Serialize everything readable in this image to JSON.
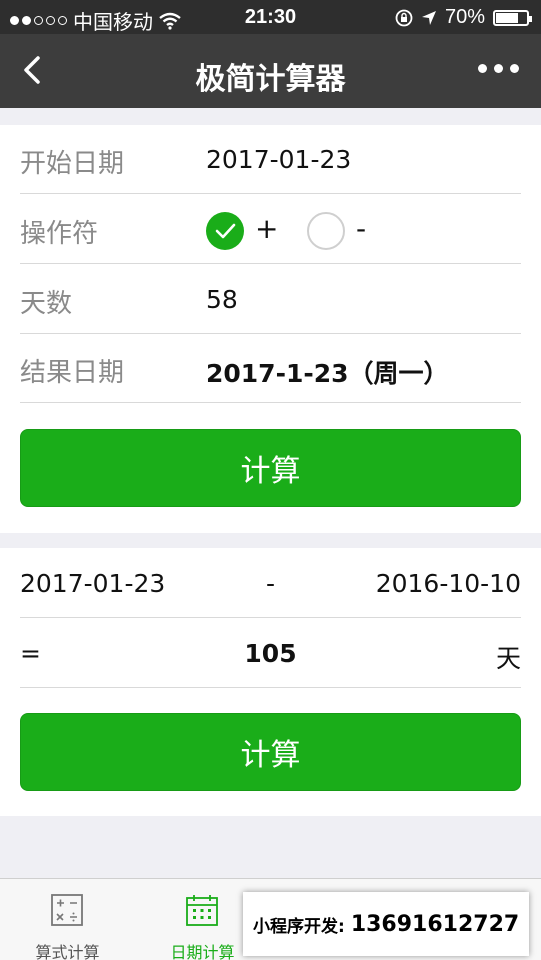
{
  "statusbar": {
    "carrier": "中国移动",
    "time": "21:30",
    "battery": "70%",
    "battery_level": 0.7
  },
  "navbar": {
    "title": "极简计算器"
  },
  "calc1": {
    "start_label": "开始日期",
    "start_value": "2017-01-23",
    "op_label": "操作符",
    "op_plus": "+",
    "op_minus": "-",
    "op_selected": "+",
    "days_label": "天数",
    "days_value": "58",
    "result_label": "结果日期",
    "result_value": "2017-1-23（周一）",
    "button": "计算"
  },
  "calc2": {
    "date_a": "2017-01-23",
    "minus": "-",
    "date_b": "2016-10-10",
    "equals": "=",
    "result": "105",
    "unit": "天",
    "button": "计算"
  },
  "tabbar": {
    "tabs": [
      {
        "label": "算式计算",
        "icon": "calculator-icon",
        "active": false
      },
      {
        "label": "日期计算",
        "icon": "calendar-icon",
        "active": true
      }
    ]
  },
  "overlay": {
    "prefix": "小程序开发:",
    "phone": "13691612727"
  },
  "colors": {
    "accent": "#1aad19",
    "nav_bg": "#3d3d3d",
    "status_bg": "#2e2e2e"
  }
}
